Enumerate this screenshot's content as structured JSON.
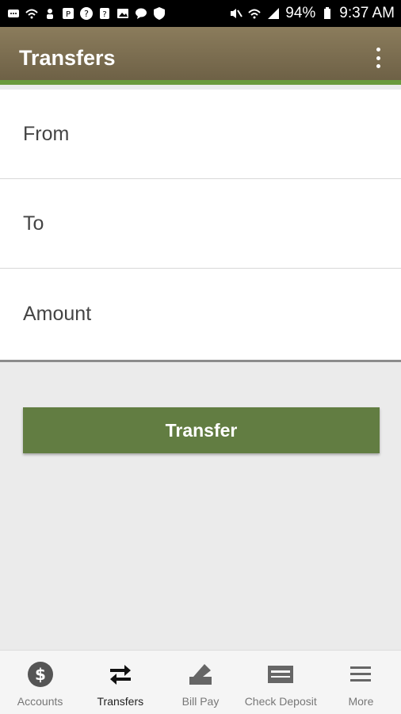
{
  "status_bar": {
    "battery": "94%",
    "time": "9:37 AM",
    "icons": [
      "message-icon",
      "wifi-icon",
      "person-icon",
      "p-icon",
      "help-icon",
      "help-icon",
      "image-icon",
      "chat-icon",
      "shield-icon",
      "mute-icon",
      "wifi-icon",
      "signal-icon",
      "battery-icon"
    ]
  },
  "app_bar": {
    "title": "Transfers"
  },
  "form": {
    "from_label": "From",
    "to_label": "To",
    "amount_label": "Amount"
  },
  "transfer_button": {
    "label": "Transfer"
  },
  "bottom_nav": {
    "items": [
      {
        "label": "Accounts",
        "icon": "dollar-icon"
      },
      {
        "label": "Transfers",
        "icon": "transfer-arrows-icon",
        "active": true
      },
      {
        "label": "Bill Pay",
        "icon": "bill-pay-icon"
      },
      {
        "label": "Check Deposit",
        "icon": "check-icon"
      },
      {
        "label": "More",
        "icon": "menu-icon"
      }
    ]
  },
  "colors": {
    "app_bar": "#7b6d50",
    "accent": "#6a9a3c",
    "button": "#627d42"
  }
}
